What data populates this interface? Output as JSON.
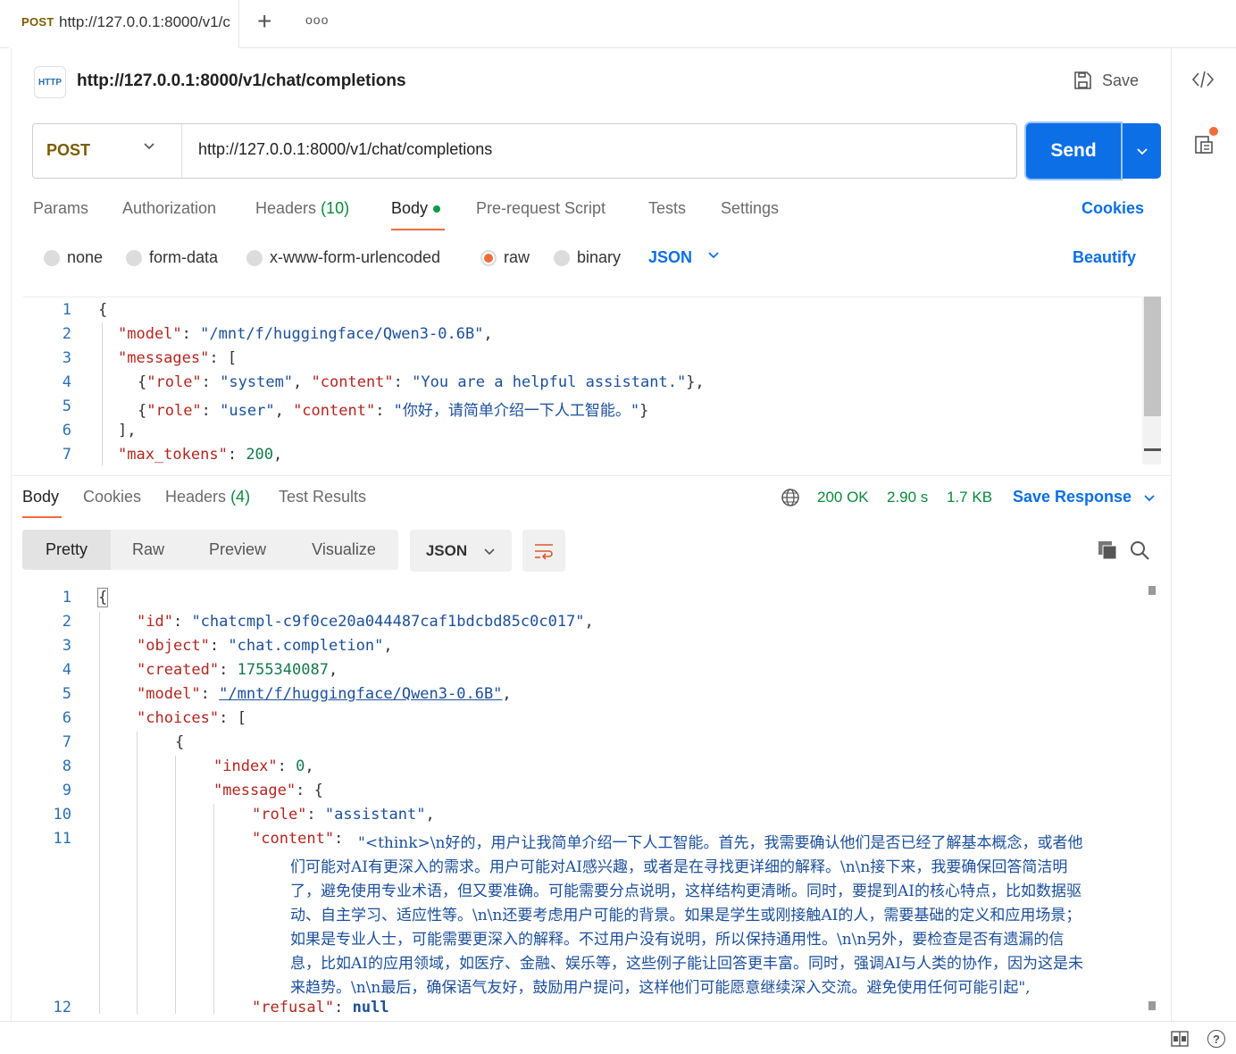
{
  "tab": {
    "method": "POST",
    "url": "http://127.0.0.1:8000/v1/c"
  },
  "tabbar": {
    "new_tab": "+",
    "more": "ooo"
  },
  "header": {
    "badge": "HTTP",
    "title": "http://127.0.0.1:8000/v1/chat/completions",
    "save_label": "Save"
  },
  "request": {
    "method": "POST",
    "url": "http://127.0.0.1:8000/v1/chat/completions",
    "send_label": "Send",
    "tabs": [
      {
        "label": "Params"
      },
      {
        "label": "Authorization"
      },
      {
        "label": "Headers",
        "count": "(10)"
      },
      {
        "label": "Body"
      },
      {
        "label": "Pre-request Script"
      },
      {
        "label": "Tests"
      },
      {
        "label": "Settings"
      }
    ],
    "cookies_label": "Cookies",
    "body_types": [
      "none",
      "form-data",
      "x-www-form-urlencoded",
      "raw",
      "binary"
    ],
    "selected_body_type": "raw",
    "format": "JSON",
    "beautify_label": "Beautify"
  },
  "request_body_lines": [
    "1",
    "2",
    "3",
    "4",
    "5",
    "6",
    "7"
  ],
  "request_body": {
    "l1": "{",
    "l2k": "\"model\"",
    "l2v": "\"/mnt/f/huggingface/Qwen3-0.6B\"",
    "l3k": "\"messages\"",
    "l3v": "[",
    "l4a": "{",
    "l4k1": "\"role\"",
    "l4v1": "\"system\"",
    "l4k2": "\"content\"",
    "l4v2": "\"You are a helpful assistant.\"",
    "l4e": "},",
    "l5a": "{",
    "l5k1": "\"role\"",
    "l5v1": "\"user\"",
    "l5k2": "\"content\"",
    "l5v2": "\"你好，请简单介绍一下人工智能。\"",
    "l5e": "}",
    "l6": "],",
    "l7k": "\"max_tokens\"",
    "l7v": "200"
  },
  "response": {
    "tabs": [
      {
        "label": "Body"
      },
      {
        "label": "Cookies"
      },
      {
        "label": "Headers",
        "count": "(4)"
      },
      {
        "label": "Test Results"
      }
    ],
    "status": "200 OK",
    "time": "2.90 s",
    "size": "1.7 KB",
    "save_label": "Save Response",
    "view_modes": [
      "Pretty",
      "Raw",
      "Preview",
      "Visualize"
    ],
    "format": "JSON"
  },
  "response_body_lines": [
    "1",
    "2",
    "3",
    "4",
    "5",
    "6",
    "7",
    "8",
    "9",
    "10",
    "11",
    "12"
  ],
  "response_body": {
    "l1": "{",
    "l2k": "\"id\"",
    "l2v": "\"chatcmpl-c9f0ce20a044487caf1bdcbd85c0c017\"",
    "l3k": "\"object\"",
    "l3v": "\"chat.completion\"",
    "l4k": "\"created\"",
    "l4v": "1755340087",
    "l5k": "\"model\"",
    "l5v": "\"/mnt/f/huggingface/Qwen3-0.6B\"",
    "l6k": "\"choices\"",
    "l6v": "[",
    "l7": "{",
    "l8k": "\"index\"",
    "l8v": "0",
    "l9k": "\"message\"",
    "l9v": "{",
    "l10k": "\"role\"",
    "l10v": "\"assistant\"",
    "l11k": "\"content\"",
    "content_lines": [
      "\"<think>\\n好的，用户让我简单介绍一下人工智能。首先，我需要确认他们是否已经了解基本概念，或者他",
      "们可能对AI有更深入的需求。用户可能对AI感兴趣，或者是在寻找更详细的解释。\\n\\n接下来，我要确保回答简洁明",
      "了，避免使用专业术语，但又要准确。可能需要分点说明，这样结构更清晰。同时，要提到AI的核心特点，比如数据驱",
      "动、自主学习、适应性等。\\n\\n还要考虑用户可能的背景。如果是学生或刚接触AI的人，需要基础的定义和应用场景；",
      "如果是专业人士，可能需要更深入的解释。不过用户没有说明，所以保持通用性。\\n\\n另外，要检查是否有遗漏的信",
      "息，比如AI的应用领域，如医疗、金融、娱乐等，这些例子能让回答更丰富。同时，强调AI与人类的协作，因为这是未",
      "来趋势。\\n\\n最后，确保语气友好，鼓励用户提问，这样他们可能愿意继续深入交流。避免使用任何可能引起\","
    ],
    "l12k": "\"refusal\"",
    "l12v": "null"
  },
  "colors": {
    "accent": "#0c6fe6",
    "method": "#7a5c00",
    "status": "#0a8a3a",
    "tab_indicator": "#f26b3a"
  }
}
